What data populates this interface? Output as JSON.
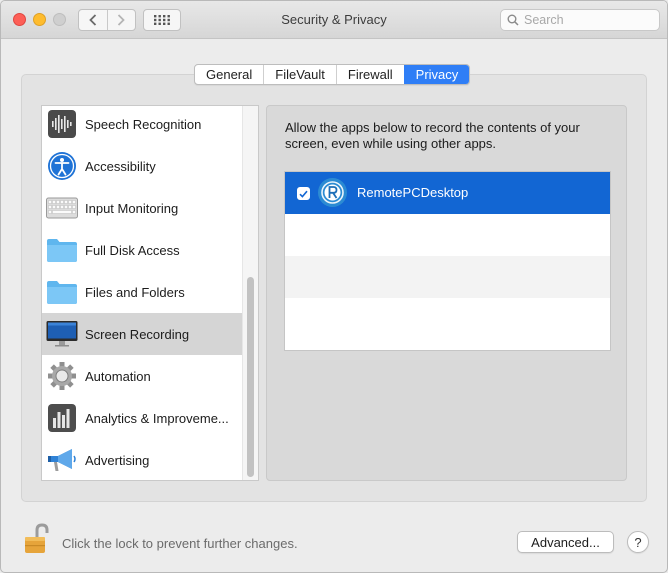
{
  "window": {
    "title": "Security & Privacy",
    "search_placeholder": "Search"
  },
  "tabs": [
    {
      "label": "General",
      "active": false
    },
    {
      "label": "FileVault",
      "active": false
    },
    {
      "label": "Firewall",
      "active": false
    },
    {
      "label": "Privacy",
      "active": true
    }
  ],
  "sidebar": {
    "items": [
      {
        "label": "Speech Recognition",
        "icon": "speech-recognition-icon",
        "selected": false
      },
      {
        "label": "Accessibility",
        "icon": "accessibility-icon",
        "selected": false
      },
      {
        "label": "Input Monitoring",
        "icon": "keyboard-icon",
        "selected": false
      },
      {
        "label": "Full Disk Access",
        "icon": "folder-icon",
        "selected": false
      },
      {
        "label": "Files and Folders",
        "icon": "folder-icon",
        "selected": false
      },
      {
        "label": "Screen Recording",
        "icon": "display-icon",
        "selected": true
      },
      {
        "label": "Automation",
        "icon": "gear-icon",
        "selected": false
      },
      {
        "label": "Analytics & Improveme...",
        "icon": "analytics-icon",
        "selected": false
      },
      {
        "label": "Advertising",
        "icon": "megaphone-icon",
        "selected": false
      }
    ]
  },
  "main": {
    "description": "Allow the apps below to record the contents of your screen, even while using other apps.",
    "apps": [
      {
        "name": "RemotePCDesktop",
        "checked": true,
        "icon": "remotepc-app-icon"
      }
    ]
  },
  "footer": {
    "lock_text": "Click the lock to prevent further changes.",
    "advanced_label": "Advanced...",
    "help_label": "?"
  },
  "colors": {
    "accent": "#2f7ef6",
    "selection": "#1266d3"
  }
}
